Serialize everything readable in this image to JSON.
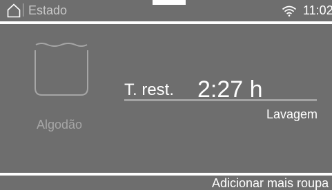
{
  "status_bar": {
    "title": "Estado",
    "time": "11:02",
    "icons": [
      "home-icon",
      "wifi-icon"
    ]
  },
  "program": {
    "name": "Algodão",
    "icon": "cotton-tub-icon"
  },
  "remaining": {
    "label": "T. rest.",
    "value": "2:27 h"
  },
  "phase": "Lavagem",
  "bottom_action": "Adicionar mais roupa",
  "colors": {
    "panel": "#6e6e6e",
    "text": "#ffffff",
    "dim_text": "#a6a6a6"
  }
}
